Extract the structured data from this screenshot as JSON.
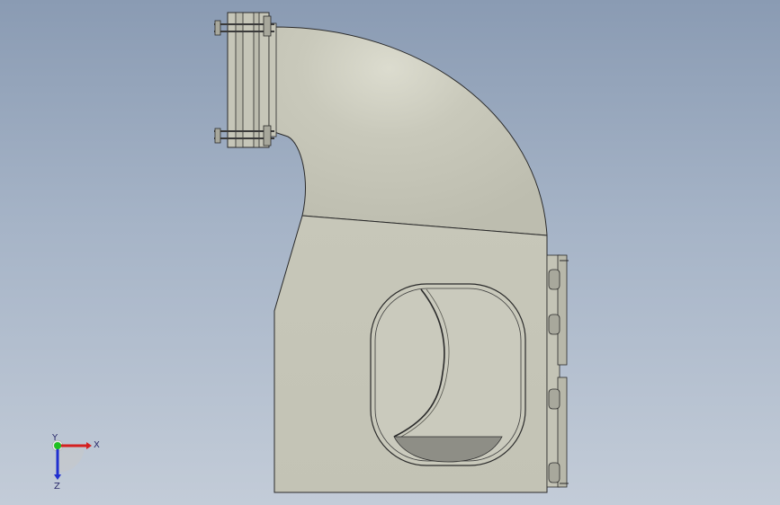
{
  "viewport": {
    "background_top": "#8a9bb3",
    "background_bottom": "#c3ccd8"
  },
  "model": {
    "body_color": "#c4c4b6",
    "body_highlight": "#d8d8cc",
    "outline_color": "#2a2a2a",
    "opening_fill": "#8e8e86"
  },
  "triad": {
    "x_label": "X",
    "y_label": "Y",
    "z_label": "Z",
    "x_color": "#d42020",
    "y_color": "#20c020",
    "z_color": "#2030d0"
  }
}
